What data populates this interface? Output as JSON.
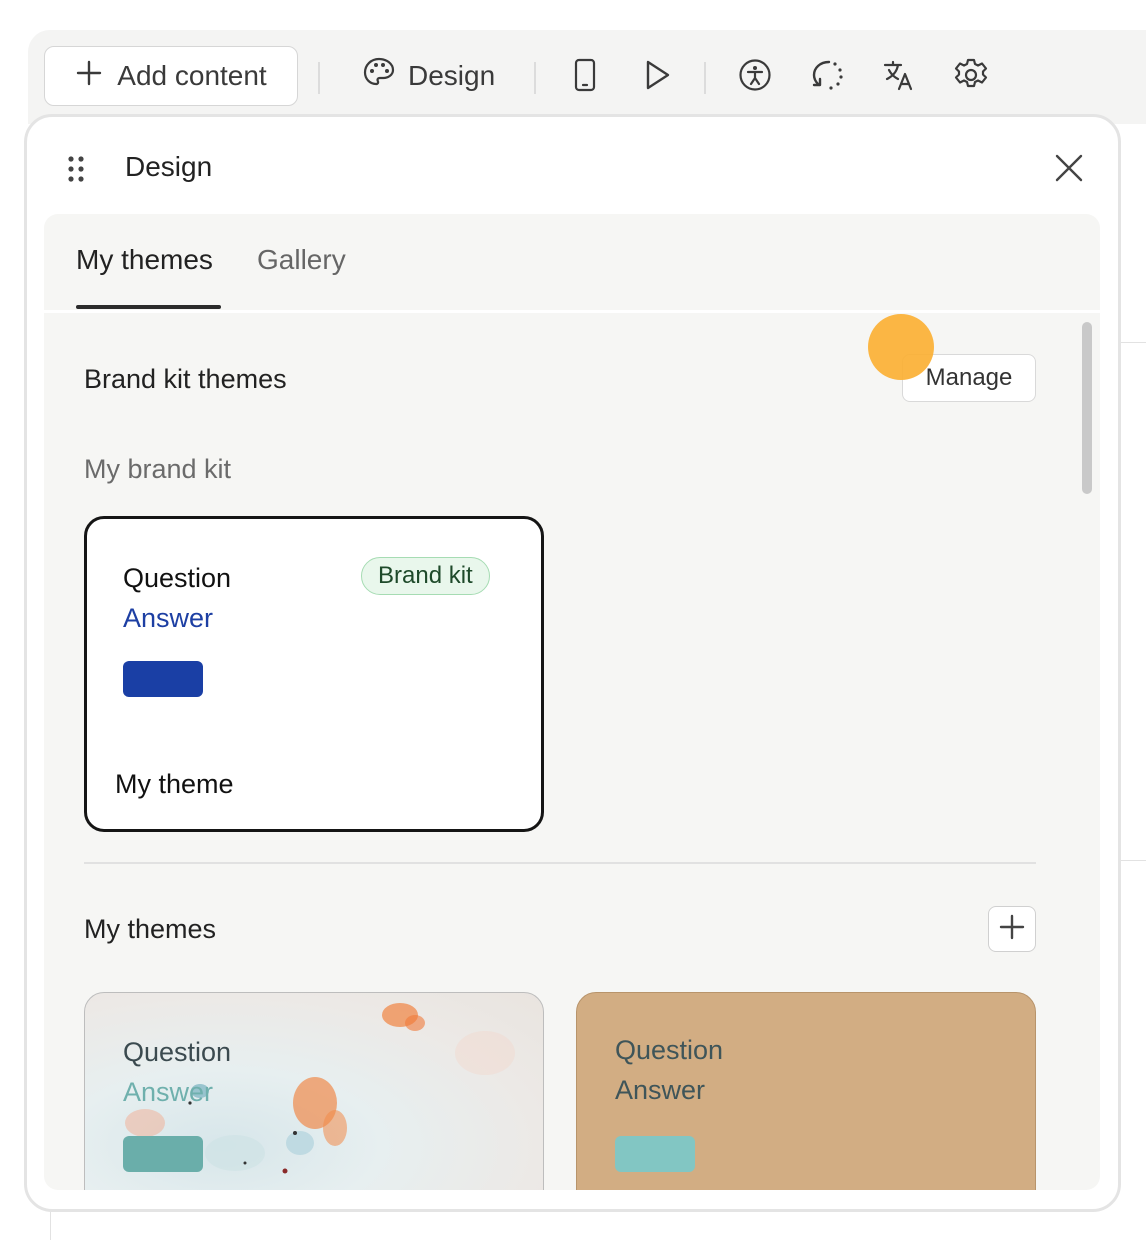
{
  "toolbar": {
    "add_content_label": "Add content",
    "design_label": "Design",
    "icons": [
      "plus-icon",
      "palette-icon",
      "mobile-preview-icon",
      "play-icon",
      "accessibility-icon",
      "logic-icon",
      "translate-icon",
      "settings-icon"
    ]
  },
  "panel": {
    "title": "Design",
    "tabs": [
      {
        "label": "My themes",
        "active": true
      },
      {
        "label": "Gallery",
        "active": false
      }
    ],
    "brand_section": {
      "title": "Brand kit themes",
      "manage_label": "Manage",
      "subheading": "My brand kit",
      "card": {
        "question": "Question",
        "answer": "Answer",
        "badge": "Brand kit",
        "name": "My theme",
        "answer_color": "#1d3fa3",
        "button_color": "#1a3fa5"
      }
    },
    "my_themes_section": {
      "title": "My themes",
      "cards": [
        {
          "question": "Question",
          "answer": "Answer",
          "question_color": "#3b4a4f",
          "answer_color": "#6fb0ad",
          "button_color": "#6aaeaa"
        },
        {
          "question": "Question",
          "answer": "Answer",
          "question_color": "#3f5559",
          "answer_color": "#3f5559",
          "button_color": "#82c6c3",
          "background": "#d2ad83"
        }
      ]
    }
  }
}
